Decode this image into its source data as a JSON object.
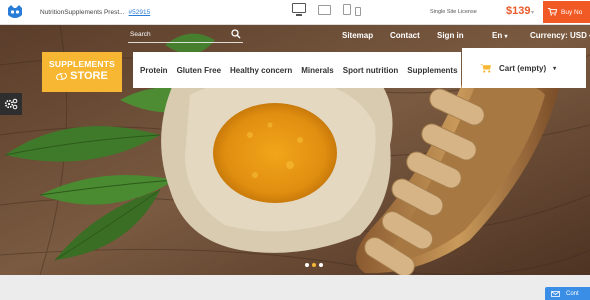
{
  "topbar": {
    "product_name": "NutritionSupplements Prest...",
    "product_id": "#52915",
    "license": "Single Site License",
    "price": "$139",
    "buy_label": "Buy No",
    "devices": [
      "desktop-icon",
      "tablet-icon",
      "phone-icon"
    ]
  },
  "header": {
    "search_placeholder": "Search",
    "util_links": {
      "sitemap": "Sitemap",
      "contact": "Contact",
      "signin": "Sign in",
      "language": "En",
      "currency": "Currency: USD"
    },
    "logo": {
      "line1": "SUPPLEMENTS",
      "line2": "STORE"
    },
    "menu": [
      "Protein",
      "Gluten Free",
      "Healthy concern",
      "Minerals",
      "Sport nutrition",
      "Supplements"
    ],
    "cart_label": "Cart (empty)"
  },
  "slider": {
    "dot_count": 3,
    "active_dot": 1
  },
  "chat": {
    "label": "Cont"
  },
  "colors": {
    "accent_orange": "#f15a24",
    "price_orange": "#e85a2a",
    "brand_yellow": "#f7b733",
    "link_blue": "#2a7dd6"
  }
}
